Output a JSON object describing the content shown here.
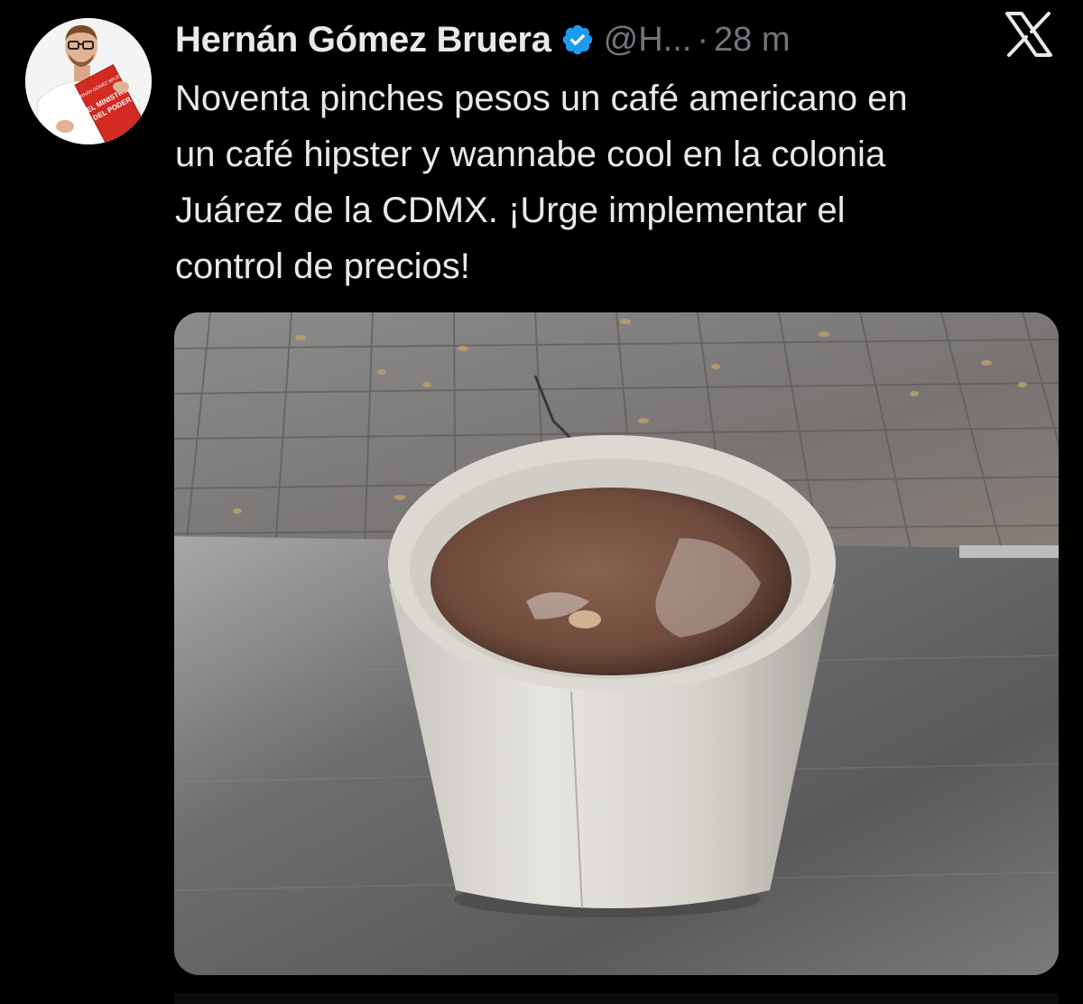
{
  "tweet": {
    "author": {
      "display_name": "Hernán Gómez Bruera",
      "handle": "@H...",
      "verified": true,
      "avatar_book": {
        "author_line": "HERNÁN GÓMEZ BRUERA",
        "title_line1": "EL MINISTRO",
        "title_line2": "DEL PODER"
      }
    },
    "separator": "·",
    "timestamp": "28 m",
    "text": "Noventa pinches pesos un café americano en\nun café hipster y wannabe cool en la colonia\nJuárez de la CDMX. ¡Urge implementar el\ncontrol de precios!",
    "platform_icon": "x-logo-icon",
    "media": {
      "kind": "photo",
      "icon": "coffee-cup-photo"
    }
  },
  "colors": {
    "background": "#000000",
    "text_primary": "#e7e9ea",
    "text_secondary": "#71767b",
    "verified_badge": "#1d9bf0"
  }
}
